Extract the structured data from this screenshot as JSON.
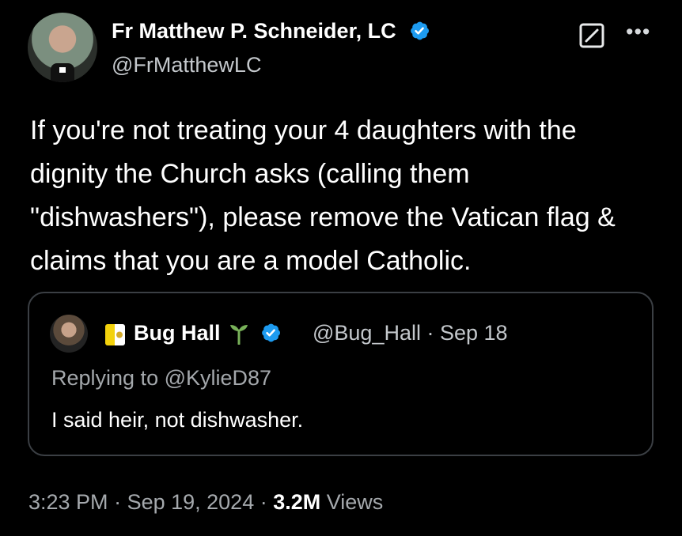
{
  "tweet": {
    "author": {
      "name": "Fr Matthew P. Schneider, LC",
      "handle": "@FrMatthewLC",
      "verified_color": "#1d9bf0"
    },
    "text": "If you're not treating your 4 daughters with the dignity the Church asks (calling them \"dishwashers\"), please remove the Vatican flag & claims that you are a model Catholic.",
    "time": "3:23 PM",
    "separator_1": " · ",
    "date": "Sep 19, 2024",
    "separator_2": " · ",
    "views_count": "3.2M",
    "views_label": " Views"
  },
  "quoted_tweet": {
    "name": "Bug Hall",
    "handle_and_date": "@Bug_Hall · Sep 18",
    "replying_to": "Replying to @KylieD87",
    "text": "I said heir, not dishwasher.",
    "verified_color": "#1d9bf0",
    "flag_colors": [
      "#f3d20c",
      "#ffffff"
    ]
  },
  "icons": {
    "author_avatar": "priest-avatar",
    "verified": "verified-badge-icon",
    "grok": "grok-icon",
    "more": "more-icon",
    "quoted_avatar": "bug-hall-avatar",
    "flag": "vatican-flag-icon",
    "seedling": "seedling-icon"
  }
}
